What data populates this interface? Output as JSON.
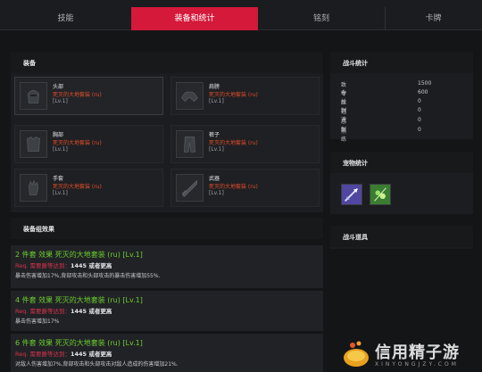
{
  "tabs": [
    "技能",
    "装备和统计",
    "铭刻",
    "卡牌"
  ],
  "active_tab": "装备和统计",
  "equipment_panel": {
    "title": "装备",
    "slots": [
      {
        "type": "头部",
        "name": "死灭的大地套装 (ru)",
        "level": "[Lv.1]"
      },
      {
        "type": "肩膀",
        "name": "死灭的大地套装 (ru)",
        "level": "[Lv.1]"
      },
      {
        "type": "胸部",
        "name": "死灭的大地套装 (ru)",
        "level": "[Lv.1]"
      },
      {
        "type": "裤子",
        "name": "死灭的大地套装 (ru)",
        "level": "[Lv.1]"
      },
      {
        "type": "手套",
        "name": "死灭的大地套装 (ru)",
        "level": "[Lv.1]"
      },
      {
        "type": "武器",
        "name": "死灭的大地套装 (ru)",
        "level": "[Lv.1]"
      }
    ]
  },
  "set_effects": {
    "title": "装备组效果",
    "items": [
      {
        "title": "2 件套 效果 死灭的大地套装 (ru) [Lv.1]",
        "req_prefix": "Req. 需要爵等达到：",
        "req_value": "1445 或者更高",
        "desc": "暴击伤害增加17%,背部攻击和头部攻击的暴击伤害增加55%."
      },
      {
        "title": "4 件套 效果 死灭的大地套装 (ru) [Lv.1]",
        "req_prefix": "Req. 需要爵等达到：",
        "req_value": "1445 或者更高",
        "desc": "暴击伤害增加17%"
      },
      {
        "title": "6 件套 效果 死灭的大地套装 (ru) [Lv.1]",
        "req_prefix": "Req. 需要爵等达到：",
        "req_value": "1445 或者更高",
        "desc": "对敌人伤害增加7%,背部攻击和头部攻击对敌人造成的伤害增加21%."
      }
    ]
  },
  "combat_stats": {
    "title": "战斗统计",
    "rows": [
      {
        "label": "致命",
        "value": "1500"
      },
      {
        "label": "专长",
        "value": "600"
      },
      {
        "label": "压制",
        "value": "0"
      },
      {
        "label": "迅速",
        "value": "0"
      },
      {
        "label": "忍耐",
        "value": "0"
      },
      {
        "label": "熟练",
        "value": "0"
      }
    ]
  },
  "pet_stats": {
    "title": "宠物统计"
  },
  "combat_items": {
    "title": "战斗道具"
  },
  "watermark": {
    "text": "信用精子游",
    "sub": "XINYONGJZY.COM"
  },
  "colors": {
    "accent": "#d5193a",
    "item_name": "#e14d2a",
    "set_title": "#6bcf2e",
    "req": "#d6334a"
  }
}
